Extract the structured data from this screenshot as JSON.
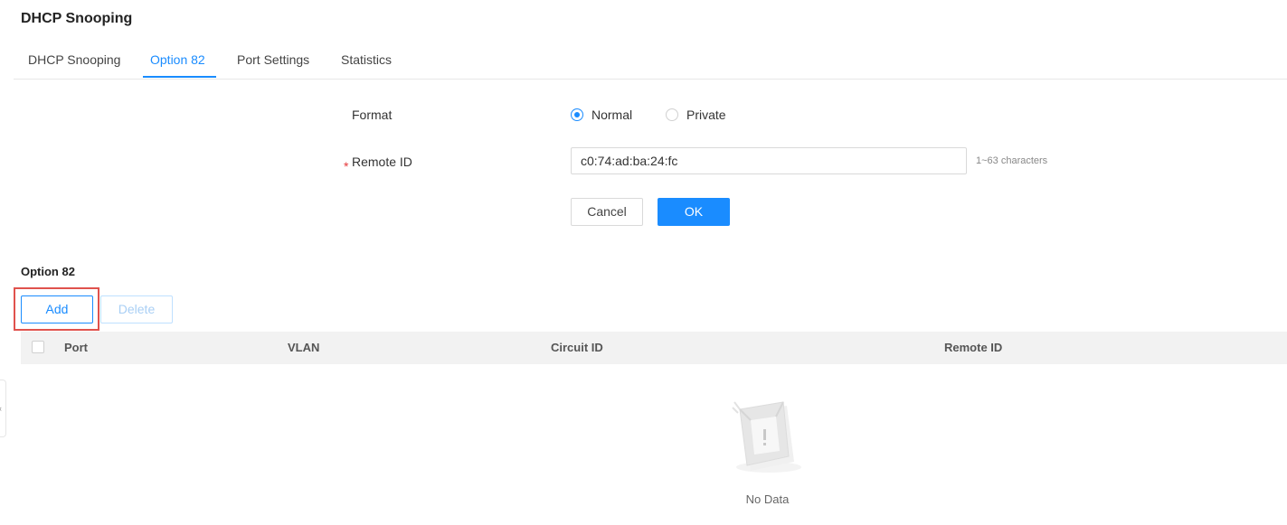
{
  "page": {
    "title": "DHCP Snooping"
  },
  "tabs": [
    {
      "label": "DHCP Snooping",
      "active": false
    },
    {
      "label": "Option 82",
      "active": true
    },
    {
      "label": "Port Settings",
      "active": false
    },
    {
      "label": "Statistics",
      "active": false
    }
  ],
  "form": {
    "format_label": "Format",
    "format_options": [
      {
        "label": "Normal",
        "checked": true
      },
      {
        "label": "Private",
        "checked": false
      }
    ],
    "required_mark": "*",
    "remote_id_label": "Remote ID",
    "remote_id_value": "c0:74:ad:ba:24:fc",
    "remote_id_hint": "1~63 characters",
    "cancel_label": "Cancel",
    "ok_label": "OK"
  },
  "table_section": {
    "title": "Option 82",
    "add_label": "Add",
    "delete_label": "Delete",
    "columns": [
      "Port",
      "VLAN",
      "Circuit ID",
      "Remote ID"
    ],
    "rows": [],
    "empty_text": "No Data"
  },
  "colors": {
    "accent": "#1a8cff",
    "highlight": "#e0524d"
  }
}
